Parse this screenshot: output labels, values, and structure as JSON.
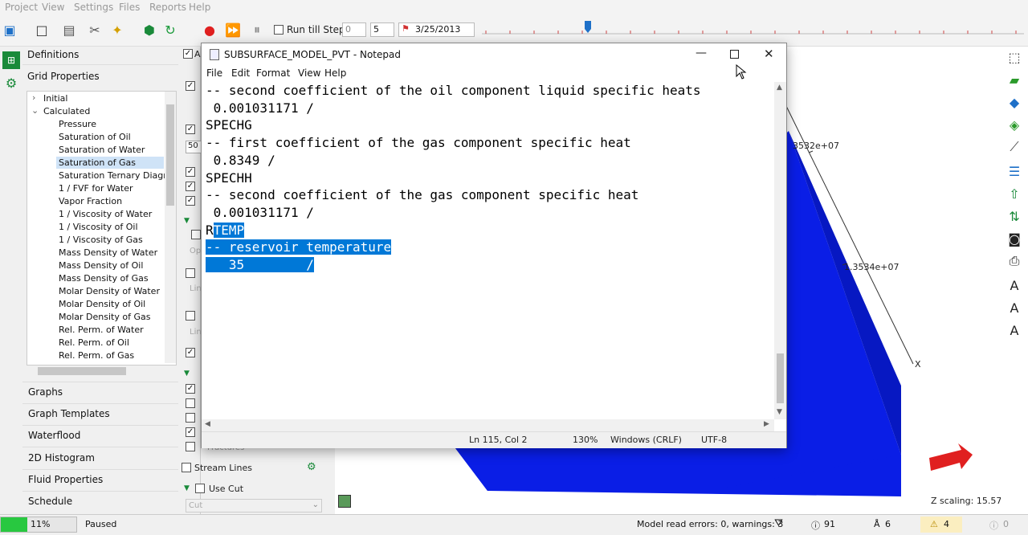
{
  "menubar": {
    "items": [
      "Project",
      "View",
      "Settings",
      "Files",
      "Reports",
      "Help"
    ]
  },
  "toolbar": {
    "run_till_step_label": "Run till Step:",
    "step_from": "0",
    "step_to": "5",
    "date": "3/25/2013"
  },
  "left_panel": {
    "definitions": "Definitions",
    "grid_properties": "Grid Properties",
    "tree": {
      "initial": "Initial",
      "calculated": "Calculated",
      "items": [
        "Pressure",
        "Saturation of Oil",
        "Saturation of Water",
        "Saturation of Gas",
        "Saturation Ternary Diagram",
        "1 / FVF for Water",
        "Vapor Fraction",
        "1 / Viscosity of Water",
        "1 / Viscosity of Oil",
        "1 / Viscosity of Gas",
        "Mass Density of Water",
        "Mass Density of Oil",
        "Mass Density of Gas",
        "Molar Density of Water",
        "Molar Density of Oil",
        "Molar Density of Gas",
        "Rel. Perm. of Water",
        "Rel. Perm. of Oil",
        "Rel. Perm. of Gas"
      ],
      "selected": "Saturation of Gas"
    },
    "sections": [
      "Graphs",
      "Graph Templates",
      "Waterflood",
      "2D Histogram",
      "Fluid Properties",
      "Schedule"
    ]
  },
  "mid_panel": {
    "frag_a": "A",
    "frag_50": "50",
    "frag_op": "Op",
    "frag_lin": "Lin",
    "frag_lin2": "Lin",
    "frag_fractures": "Fractures",
    "stream_lines": "Stream Lines",
    "use_cut": "Use Cut",
    "cut_placeholder": "Cut"
  },
  "view3d": {
    "label_top": "3532e+07",
    "label_mid": "1.3534e+07",
    "axis_x": "X",
    "z_scaling": "Z scaling: 15.574"
  },
  "notepad": {
    "title": "SUBSURFACE_MODEL_PVT - Notepad",
    "menu": [
      "File",
      "Edit",
      "Format",
      "View",
      "Help"
    ],
    "lines": [
      "-- second coefficient of the oil component liquid specific heats",
      " 0.001031171 /",
      "",
      "",
      "SPECHG",
      "-- first coefficient of the gas component specific heat",
      " 0.8349 /",
      "",
      "",
      "SPECHH",
      "-- second coefficient of the gas component specific heat",
      " 0.001031171 /",
      "",
      ""
    ],
    "sel_line1_prefix": "R",
    "sel_line1_sel": "TEMP",
    "sel_line2": "-- reservoir temperature",
    "sel_line3": "   35        /",
    "status": {
      "position": "Ln 115, Col 2",
      "zoom": "130%",
      "line_ending": "Windows (CRLF)",
      "encoding": "UTF-8"
    }
  },
  "statusbar": {
    "progress": "11%",
    "progress_value": 0.11,
    "state": "Paused",
    "model_errors": "Model read errors: 0, warnings: 3",
    "info_count": "91",
    "person_count": "6",
    "warn_count": "4",
    "err_count": "0"
  },
  "colors": {
    "accent_blue": "#0078d7",
    "model_blue": "#0a1ee6",
    "progress_green": "#28c840",
    "arrow_red": "#e02020"
  }
}
